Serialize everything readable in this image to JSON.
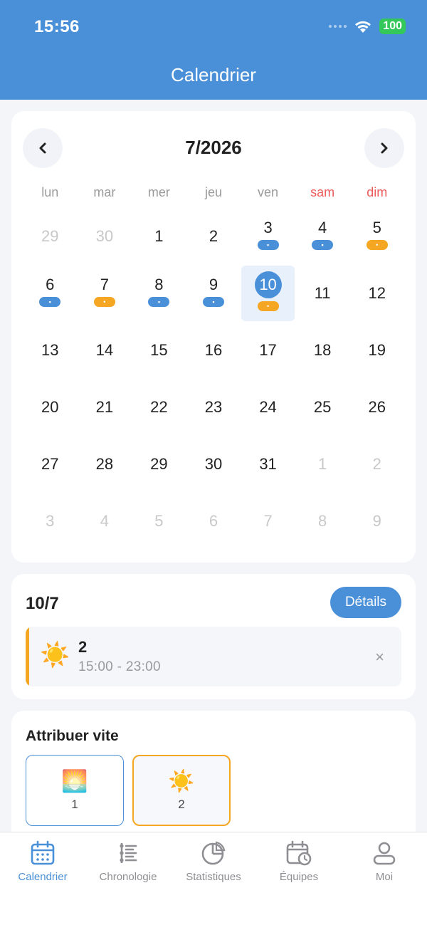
{
  "status_bar": {
    "time": "15:56",
    "battery": "100"
  },
  "header": {
    "title": "Calendrier"
  },
  "calendar": {
    "month_label": "7/2026",
    "weekdays": [
      "lun",
      "mar",
      "mer",
      "jeu",
      "ven",
      "sam",
      "dim"
    ],
    "days": [
      "29",
      "30",
      "1",
      "2",
      "3",
      "4",
      "5",
      "6",
      "7",
      "8",
      "9",
      "10",
      "11",
      "12",
      "13",
      "14",
      "15",
      "16",
      "17",
      "18",
      "19",
      "20",
      "21",
      "22",
      "23",
      "24",
      "25",
      "26",
      "27",
      "28",
      "29",
      "30",
      "31",
      "1",
      "2",
      "3",
      "4",
      "5",
      "6",
      "7",
      "8",
      "9"
    ],
    "tag_icons": {
      "blue": "sunset-icon",
      "orange": "sun-icon"
    }
  },
  "day_detail": {
    "date": "10/7",
    "details_button": "Détails",
    "shift": {
      "icon": "sun-icon",
      "name": "2",
      "time": "15:00 - 23:00",
      "close": "×"
    }
  },
  "quick_assign": {
    "title": "Attribuer vite",
    "items": [
      {
        "icon": "sunset-icon",
        "label": "1"
      },
      {
        "icon": "sun-icon",
        "label": "2"
      }
    ]
  },
  "tabbar": {
    "tabs": [
      {
        "label": "Calendrier",
        "active": true
      },
      {
        "label": "Chronologie",
        "active": false
      },
      {
        "label": "Statistiques",
        "active": false
      },
      {
        "label": "Équipes",
        "active": false
      },
      {
        "label": "Moi",
        "active": false
      }
    ]
  },
  "colors": {
    "primary": "#4a90d9",
    "orange": "#f5a623",
    "weekend": "#ee5a5a"
  }
}
